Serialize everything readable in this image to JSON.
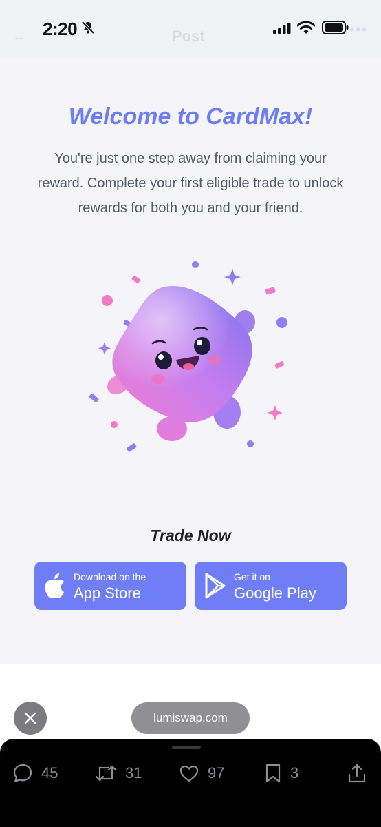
{
  "status_bar": {
    "time": "2:20"
  },
  "header": {
    "faded_title": "Post"
  },
  "content": {
    "title": "Welcome to CardMax!",
    "description": "You're just one step away from claiming your reward. Complete your first eligible trade to unlock rewards for both you and your friend.",
    "cta_heading": "Trade Now",
    "app_store": {
      "small": "Download on the",
      "big": "App Store"
    },
    "google_play": {
      "small": "Get it on",
      "big": "Google Play"
    }
  },
  "overlay": {
    "domain": "lumiswap.com"
  },
  "actions": {
    "replies": "45",
    "reposts": "31",
    "likes": "97",
    "bookmarks": "3"
  },
  "colors": {
    "accent": "#6f7df6",
    "title": "#6d7ef5",
    "card_bg": "#f4f4f9"
  }
}
